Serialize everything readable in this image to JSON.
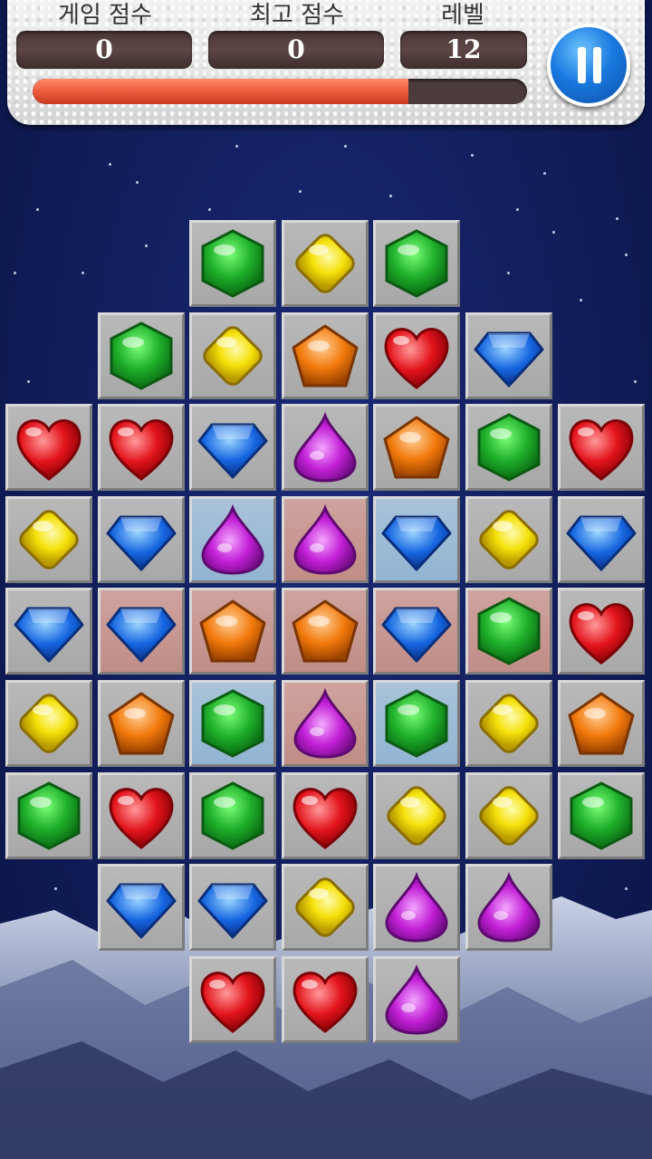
{
  "hud": {
    "game_score_label": "게임 점수",
    "game_score": "0",
    "best_score_label": "최고 점수",
    "best_score": "0",
    "level_label": "레벨",
    "level": "12",
    "level_progress": 0.76
  },
  "board": {
    "columns": 7,
    "rows": 9,
    "tiles": [
      {
        "row": 0,
        "col": 2,
        "gem": "green-hexagon"
      },
      {
        "row": 0,
        "col": 3,
        "gem": "yellow-diamond"
      },
      {
        "row": 0,
        "col": 4,
        "gem": "green-hexagon"
      },
      {
        "row": 1,
        "col": 1,
        "gem": "green-hexagon"
      },
      {
        "row": 1,
        "col": 2,
        "gem": "yellow-diamond"
      },
      {
        "row": 1,
        "col": 3,
        "gem": "orange-pentagon"
      },
      {
        "row": 1,
        "col": 4,
        "gem": "red-heart"
      },
      {
        "row": 1,
        "col": 5,
        "gem": "blue-gem"
      },
      {
        "row": 2,
        "col": 0,
        "gem": "red-heart"
      },
      {
        "row": 2,
        "col": 1,
        "gem": "red-heart"
      },
      {
        "row": 2,
        "col": 2,
        "gem": "blue-gem"
      },
      {
        "row": 2,
        "col": 3,
        "gem": "purple-drop"
      },
      {
        "row": 2,
        "col": 4,
        "gem": "orange-pentagon"
      },
      {
        "row": 2,
        "col": 5,
        "gem": "green-hexagon"
      },
      {
        "row": 2,
        "col": 6,
        "gem": "red-heart"
      },
      {
        "row": 3,
        "col": 0,
        "gem": "yellow-diamond"
      },
      {
        "row": 3,
        "col": 1,
        "gem": "blue-gem"
      },
      {
        "row": 3,
        "col": 2,
        "gem": "purple-drop",
        "highlight": "blue"
      },
      {
        "row": 3,
        "col": 3,
        "gem": "purple-drop",
        "highlight": "red"
      },
      {
        "row": 3,
        "col": 4,
        "gem": "blue-gem",
        "highlight": "blue"
      },
      {
        "row": 3,
        "col": 5,
        "gem": "yellow-diamond"
      },
      {
        "row": 3,
        "col": 6,
        "gem": "blue-gem"
      },
      {
        "row": 4,
        "col": 0,
        "gem": "blue-gem"
      },
      {
        "row": 4,
        "col": 1,
        "gem": "blue-gem",
        "highlight": "red"
      },
      {
        "row": 4,
        "col": 2,
        "gem": "orange-pentagon",
        "highlight": "red"
      },
      {
        "row": 4,
        "col": 3,
        "gem": "orange-pentagon",
        "highlight": "red"
      },
      {
        "row": 4,
        "col": 4,
        "gem": "blue-gem",
        "highlight": "red"
      },
      {
        "row": 4,
        "col": 5,
        "gem": "green-hexagon",
        "highlight": "red"
      },
      {
        "row": 4,
        "col": 6,
        "gem": "red-heart"
      },
      {
        "row": 5,
        "col": 0,
        "gem": "yellow-diamond"
      },
      {
        "row": 5,
        "col": 1,
        "gem": "orange-pentagon"
      },
      {
        "row": 5,
        "col": 2,
        "gem": "green-hexagon",
        "highlight": "blue"
      },
      {
        "row": 5,
        "col": 3,
        "gem": "purple-drop",
        "highlight": "red"
      },
      {
        "row": 5,
        "col": 4,
        "gem": "green-hexagon",
        "highlight": "blue"
      },
      {
        "row": 5,
        "col": 5,
        "gem": "yellow-diamond"
      },
      {
        "row": 5,
        "col": 6,
        "gem": "orange-pentagon"
      },
      {
        "row": 6,
        "col": 0,
        "gem": "green-hexagon"
      },
      {
        "row": 6,
        "col": 1,
        "gem": "red-heart"
      },
      {
        "row": 6,
        "col": 2,
        "gem": "green-hexagon"
      },
      {
        "row": 6,
        "col": 3,
        "gem": "red-heart"
      },
      {
        "row": 6,
        "col": 4,
        "gem": "yellow-diamond"
      },
      {
        "row": 6,
        "col": 5,
        "gem": "yellow-diamond"
      },
      {
        "row": 6,
        "col": 6,
        "gem": "green-hexagon"
      },
      {
        "row": 7,
        "col": 1,
        "gem": "blue-gem"
      },
      {
        "row": 7,
        "col": 2,
        "gem": "blue-gem"
      },
      {
        "row": 7,
        "col": 3,
        "gem": "yellow-diamond"
      },
      {
        "row": 7,
        "col": 4,
        "gem": "purple-drop"
      },
      {
        "row": 7,
        "col": 5,
        "gem": "purple-drop"
      },
      {
        "row": 8,
        "col": 2,
        "gem": "red-heart"
      },
      {
        "row": 8,
        "col": 3,
        "gem": "red-heart"
      },
      {
        "row": 8,
        "col": 4,
        "gem": "purple-drop"
      }
    ]
  },
  "colors": {
    "green": "#1fb02b",
    "yellow": "#f5e10a",
    "orange": "#f27a0c",
    "red": "#e3141c",
    "blue": "#1565e0",
    "purple": "#c21fd6",
    "progress": "#ee5a3c",
    "pause": "#1a7ae0"
  },
  "icons": {
    "pause": "pause-icon"
  }
}
